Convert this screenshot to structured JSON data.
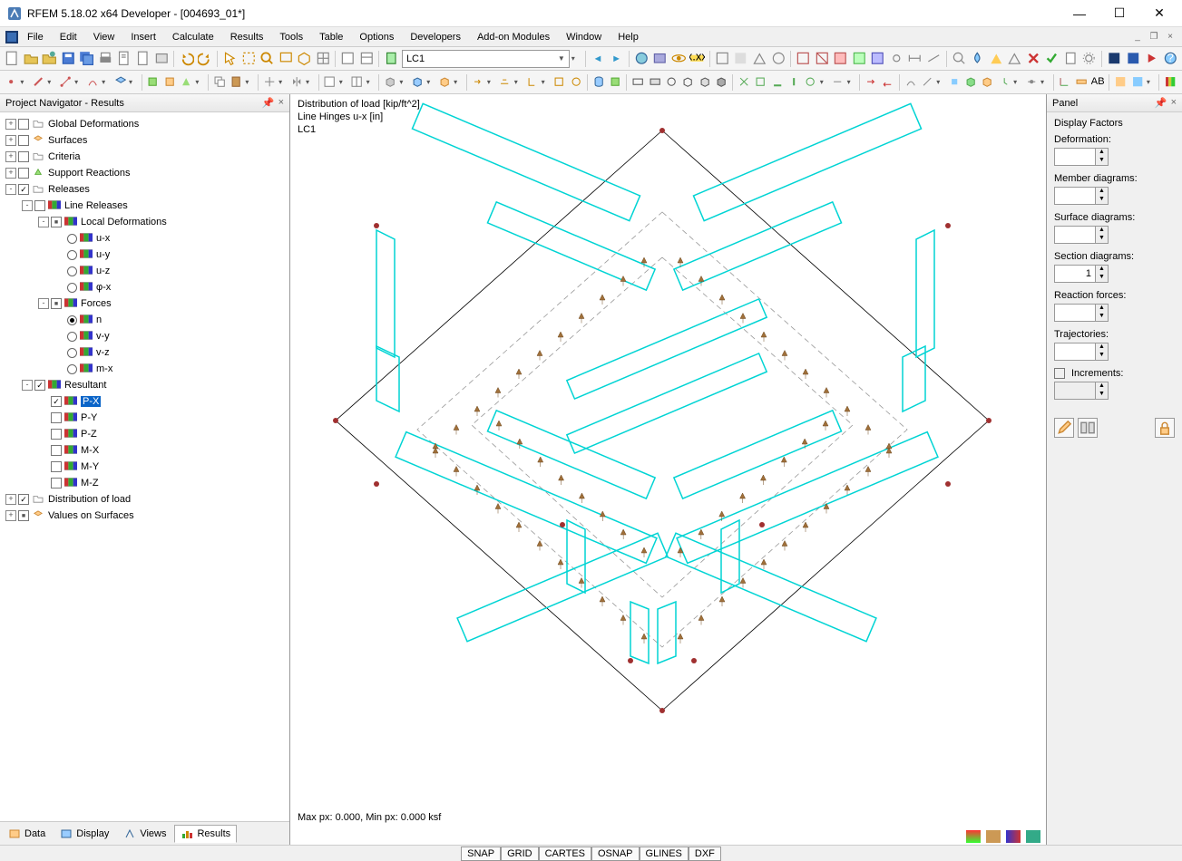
{
  "title": "RFEM 5.18.02 x64 Developer - [004693_01*]",
  "menu": [
    "File",
    "Edit",
    "View",
    "Insert",
    "Calculate",
    "Results",
    "Tools",
    "Table",
    "Options",
    "Developers",
    "Add-on Modules",
    "Window",
    "Help"
  ],
  "lc_combo": "LC1",
  "navigator": {
    "title": "Project Navigator - Results",
    "tabs": [
      "Data",
      "Display",
      "Views",
      "Results"
    ],
    "active_tab": 3,
    "tree": [
      {
        "l": 0,
        "exp": "+",
        "chk": "",
        "ico": "folder",
        "label": "Global Deformations"
      },
      {
        "l": 0,
        "exp": "+",
        "chk": "",
        "ico": "surf",
        "label": "Surfaces"
      },
      {
        "l": 0,
        "exp": "+",
        "chk": "",
        "ico": "folder",
        "label": "Criteria"
      },
      {
        "l": 0,
        "exp": "+",
        "chk": "",
        "ico": "support",
        "label": "Support Reactions"
      },
      {
        "l": 0,
        "exp": "-",
        "chk": "checked",
        "ico": "folder",
        "label": "Releases"
      },
      {
        "l": 1,
        "exp": "-",
        "chk": "",
        "ico": "flag",
        "label": "Line Releases"
      },
      {
        "l": 2,
        "exp": "-",
        "chk": "sq",
        "ico": "flag",
        "label": "Local Deformations"
      },
      {
        "l": 3,
        "exp": "",
        "radio": "off",
        "ico": "flag",
        "label": "u-x"
      },
      {
        "l": 3,
        "exp": "",
        "radio": "off",
        "ico": "flag",
        "label": "u-y"
      },
      {
        "l": 3,
        "exp": "",
        "radio": "off",
        "ico": "flag",
        "label": "u-z"
      },
      {
        "l": 3,
        "exp": "",
        "radio": "off",
        "ico": "flag",
        "label": "φ-x"
      },
      {
        "l": 2,
        "exp": "-",
        "chk": "sq",
        "ico": "flag",
        "label": "Forces"
      },
      {
        "l": 3,
        "exp": "",
        "radio": "on",
        "ico": "flag",
        "label": "n"
      },
      {
        "l": 3,
        "exp": "",
        "radio": "off",
        "ico": "flag",
        "label": "v-y"
      },
      {
        "l": 3,
        "exp": "",
        "radio": "off",
        "ico": "flag",
        "label": "v-z"
      },
      {
        "l": 3,
        "exp": "",
        "radio": "off",
        "ico": "flag",
        "label": "m-x"
      },
      {
        "l": 1,
        "exp": "-",
        "chk": "checked",
        "ico": "flag",
        "label": "Resultant"
      },
      {
        "l": 2,
        "exp": "",
        "chk": "checked",
        "ico": "flag",
        "label": "P-X",
        "sel": true
      },
      {
        "l": 2,
        "exp": "",
        "chk": "",
        "ico": "flag",
        "label": "P-Y"
      },
      {
        "l": 2,
        "exp": "",
        "chk": "",
        "ico": "flag",
        "label": "P-Z"
      },
      {
        "l": 2,
        "exp": "",
        "chk": "",
        "ico": "flag",
        "label": "M-X"
      },
      {
        "l": 2,
        "exp": "",
        "chk": "",
        "ico": "flag",
        "label": "M-Y"
      },
      {
        "l": 2,
        "exp": "",
        "chk": "",
        "ico": "flag",
        "label": "M-Z"
      },
      {
        "l": 0,
        "exp": "+",
        "chk": "checked",
        "ico": "folder",
        "label": "Distribution of load"
      },
      {
        "l": 0,
        "exp": "+",
        "chk": "sq",
        "ico": "surf",
        "label": "Values on Surfaces"
      }
    ]
  },
  "viewport": {
    "line1": "Distribution of load [kip/ft^2]",
    "line2": "Line Hinges u-x [in]",
    "line3": "LC1",
    "status": "Max px: 0.000, Min px: 0.000 ksf"
  },
  "panel": {
    "title": "Panel",
    "section": "Display Factors",
    "groups": [
      {
        "label": "Deformation:",
        "value": ""
      },
      {
        "label": "Member diagrams:",
        "value": ""
      },
      {
        "label": "Surface diagrams:",
        "value": ""
      },
      {
        "label": "Section diagrams:",
        "value": "1"
      },
      {
        "label": "Reaction forces:",
        "value": ""
      },
      {
        "label": "Trajectories:",
        "value": ""
      }
    ],
    "increments_label": "Increments:"
  },
  "statusbar": [
    "SNAP",
    "GRID",
    "CARTES",
    "OSNAP",
    "GLINES",
    "DXF"
  ]
}
